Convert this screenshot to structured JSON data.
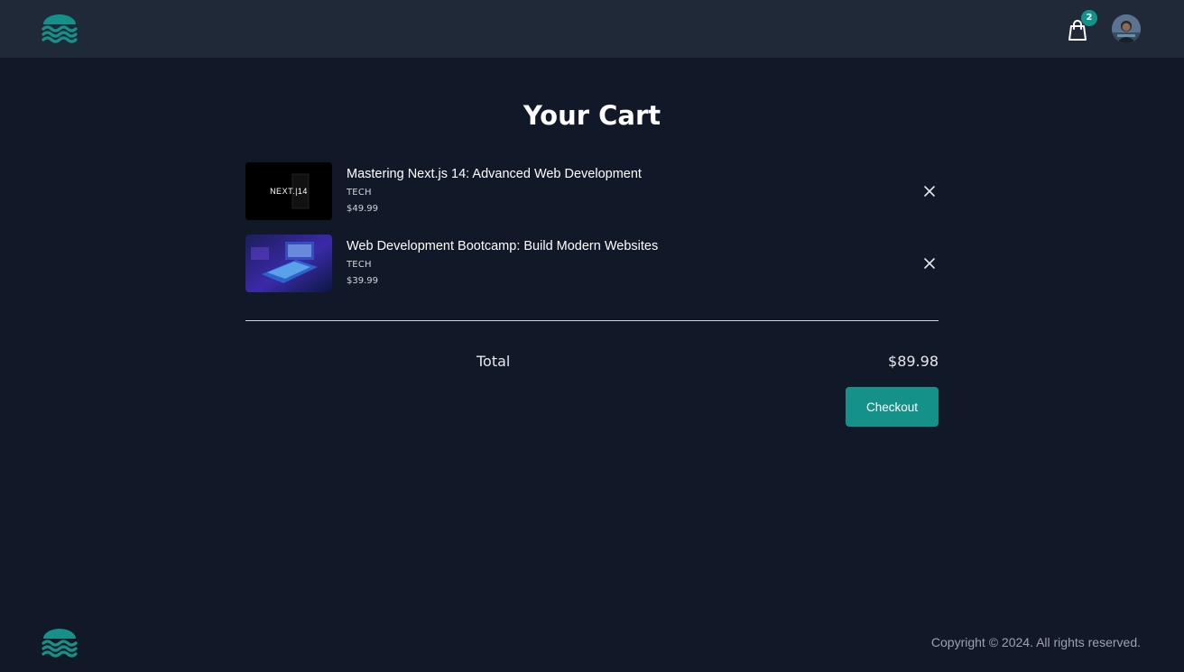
{
  "header": {
    "logo_icon": "wave-logo-icon",
    "cart_icon": "shopping-bag-icon",
    "cart_count": "2",
    "avatar_icon": "user-avatar-icon"
  },
  "main": {
    "title": "Your Cart",
    "items": [
      {
        "title": "Mastering Next.js 14: Advanced Web Development",
        "category": "TECH",
        "price": "$49.99",
        "thumb_text": "NEXT.|14",
        "remove_icon": "close-icon"
      },
      {
        "title": "Web Development Bootcamp: Build Modern Websites",
        "category": "TECH",
        "price": "$39.99",
        "remove_icon": "close-icon"
      }
    ],
    "total_label": "Total",
    "total_value": "$89.98",
    "checkout_label": "Checkout"
  },
  "footer": {
    "logo_icon": "wave-logo-icon",
    "copyright": "Copyright © 2024. All rights reserved."
  },
  "colors": {
    "background": "#111827",
    "header": "#1f2937",
    "accent": "#14928a",
    "text": "#ffffff",
    "muted": "#9ca3af"
  }
}
